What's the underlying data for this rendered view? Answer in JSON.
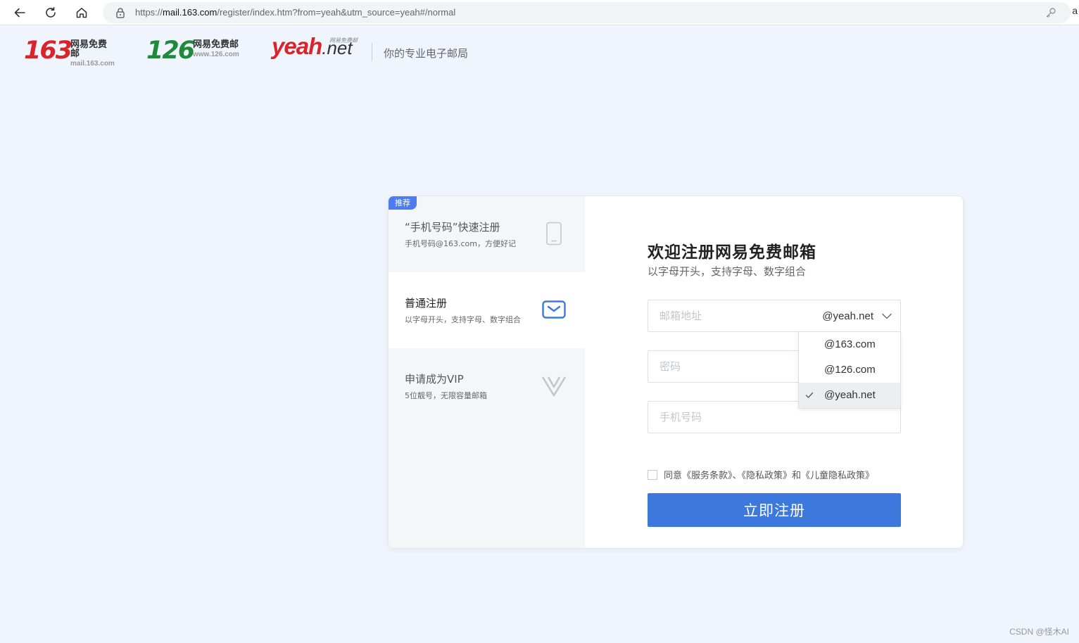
{
  "browser": {
    "url_prefix": "https://",
    "url_domain": "mail.163.com",
    "url_path": "/register/index.htm?from=yeah&utm_source=yeah#/normal",
    "extra_text": "a"
  },
  "header": {
    "logo163": {
      "number": "163",
      "title": "网易免费邮",
      "domain": "mail.163.com"
    },
    "logo126": {
      "number": "126",
      "title": "网易免费邮",
      "domain": "www.126.com"
    },
    "logoYeah": {
      "yeah": "yeah",
      "net": ".net",
      "tag": "网易免费邮"
    },
    "slogan": "你的专业电子邮局"
  },
  "sidebar": {
    "badge": "推荐",
    "items": [
      {
        "title": "“手机号码”快速注册",
        "desc": "手机号码@163.com，方便好记",
        "icon": "phone-icon",
        "active": false
      },
      {
        "title": "普通注册",
        "desc": "以字母开头，支持字母、数字组合",
        "icon": "mail-icon",
        "active": true
      },
      {
        "title": "申请成为VIP",
        "desc": "5位靓号，无限容量邮箱",
        "icon": "vip-icon",
        "active": false
      }
    ]
  },
  "form": {
    "title": "欢迎注册网易免费邮箱",
    "subtitle": "以字母开头，支持字母、数字组合",
    "email_placeholder": "邮箱地址",
    "domain_selected": "@yeah.net",
    "password_placeholder": "密码",
    "phone_placeholder": "手机号码",
    "agreement": "同意《服务条款》、《隐私政策》和《儿童隐私政策》",
    "submit_label": "立即注册"
  },
  "dropdown": {
    "options": [
      "@163.com",
      "@126.com",
      "@yeah.net"
    ],
    "selected_index": 2
  },
  "colors": {
    "accent": "#3d78dc",
    "brand163": "#d9252a",
    "brand126": "#1f8a3b",
    "page_bg": "#eff4fd"
  },
  "watermark": "CSDN @怪木AI"
}
